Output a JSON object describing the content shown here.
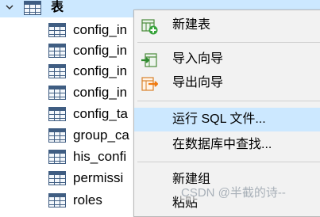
{
  "tree": {
    "header": {
      "label": "表"
    },
    "items": [
      {
        "label": "config_in"
      },
      {
        "label": "config_in"
      },
      {
        "label": "config_in"
      },
      {
        "label": "config_in"
      },
      {
        "label": "config_ta"
      },
      {
        "label": "group_ca"
      },
      {
        "label": "his_confi"
      },
      {
        "label": "permissi"
      },
      {
        "label": "roles"
      }
    ]
  },
  "context_menu": {
    "items": [
      {
        "label": "新建表",
        "icon": "new-table-icon"
      },
      {
        "label": "导入向导",
        "icon": "import-wizard-icon"
      },
      {
        "label": "导出向导",
        "icon": "export-wizard-icon"
      },
      {
        "label": "运行 SQL 文件...",
        "highlighted": true
      },
      {
        "label": "在数据库中查找..."
      },
      {
        "label": "新建组"
      },
      {
        "label": "粘贴"
      }
    ],
    "highlight_color": "#cce8ff"
  },
  "watermark": "CSDN @半截的诗--"
}
